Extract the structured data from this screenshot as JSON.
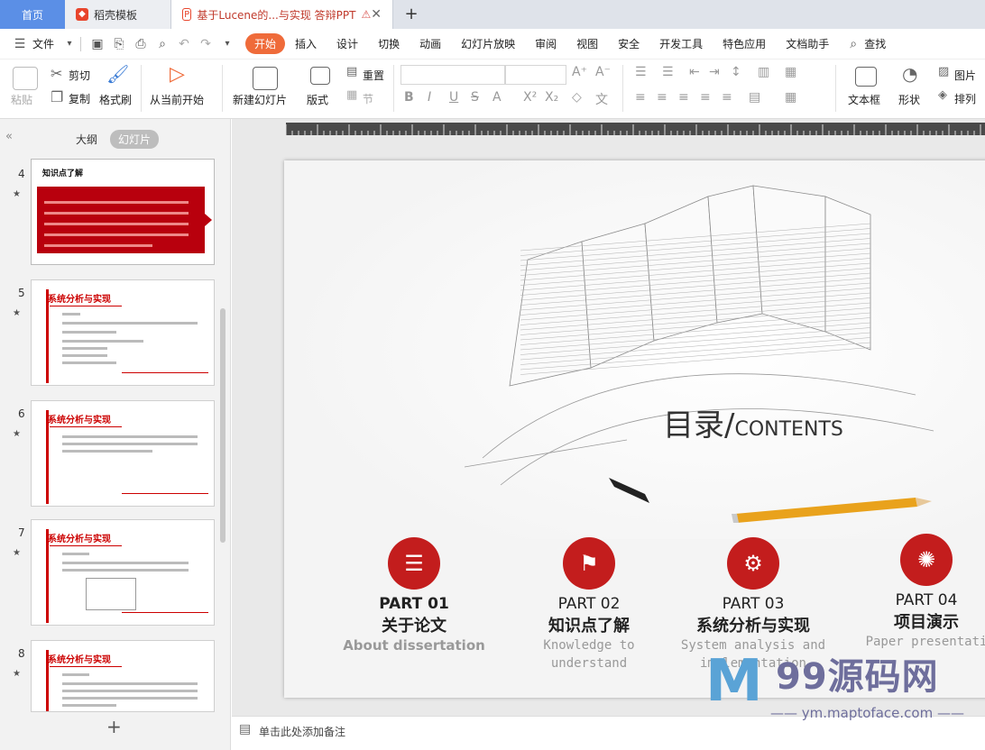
{
  "tabs": [
    {
      "label": "首页"
    },
    {
      "label": "稻壳模板"
    },
    {
      "label": "基于Lucene的...与实现 答辩PPT"
    }
  ],
  "menu": {
    "file": "文件",
    "items": [
      "开始",
      "插入",
      "设计",
      "切换",
      "动画",
      "幻灯片放映",
      "审阅",
      "视图",
      "安全",
      "开发工具",
      "特色应用",
      "文档助手"
    ],
    "search": "查找"
  },
  "ribbon": {
    "paste": "粘贴",
    "cut": "剪切",
    "copy": "复制",
    "format_painter": "格式刷",
    "play_from_current": "从当前开始",
    "new_slide": "新建幻灯片",
    "layout": "版式",
    "reset": "重置",
    "section": "节",
    "text_box": "文本框",
    "shape": "形状",
    "picture": "图片",
    "arrange": "排列"
  },
  "left_panel": {
    "outline_tab": "大纲",
    "slides_tab": "幻灯片",
    "slides": [
      {
        "num": "4",
        "title": "知识点了解"
      },
      {
        "num": "5",
        "title": "系统分析与实现"
      },
      {
        "num": "6",
        "title": "系统分析与实现"
      },
      {
        "num": "7",
        "title": "系统分析与实现"
      },
      {
        "num": "8",
        "title": "系统分析与实现"
      }
    ]
  },
  "slide": {
    "title_cn": "目录/",
    "title_en": "CONTENTS",
    "parts": [
      {
        "no": "PART 01",
        "cn": "关于论文",
        "en": "About dissertation"
      },
      {
        "no": "PART 02",
        "cn": "知识点了解",
        "en": "Knowledge to understand"
      },
      {
        "no": "PART 03",
        "cn": "系统分析与实现",
        "en": "System analysis and implementation"
      },
      {
        "no": "PART 04",
        "cn": "项目演示",
        "en": "Paper presentati"
      }
    ]
  },
  "notes_placeholder": "单击此处添加备注",
  "watermark": {
    "brand": "99源码网",
    "url": "ym.maptoface.com"
  }
}
